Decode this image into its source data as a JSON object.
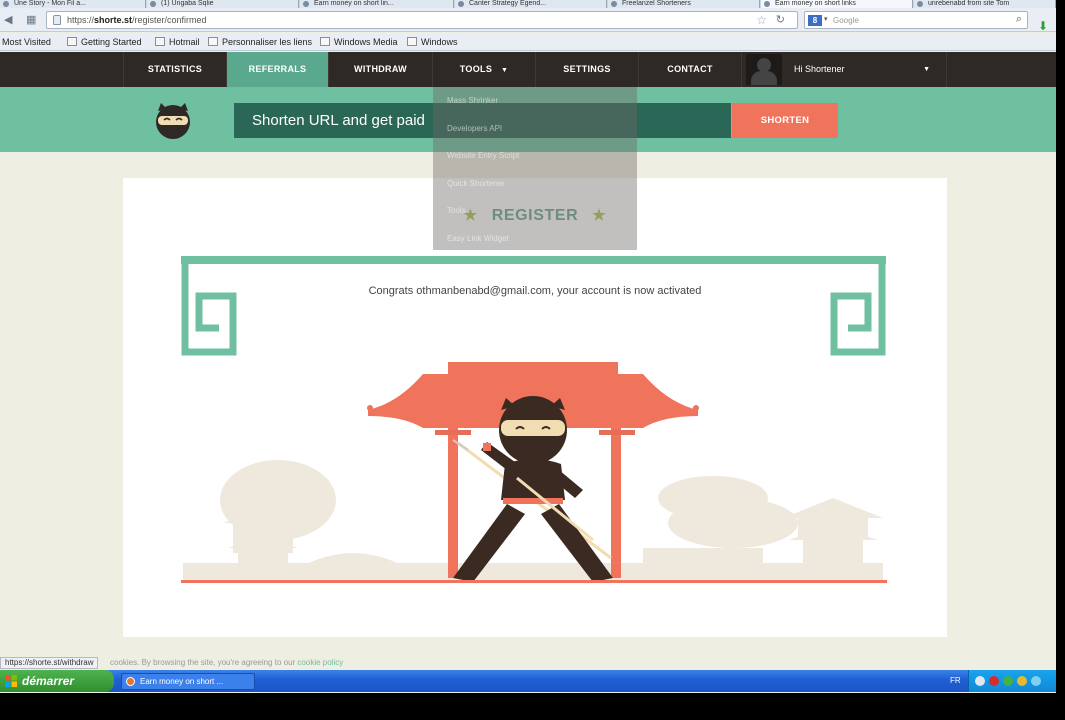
{
  "browser": {
    "tabs": [
      {
        "label": "Une Story - Mon Fil a..."
      },
      {
        "label": "(1) Ungaba Sqlie"
      },
      {
        "label": "Earn money on short lin..."
      },
      {
        "label": "Canter Strategy Egend..."
      },
      {
        "label": "Freelanzel Shorteners"
      },
      {
        "label": "Earn money on short links",
        "active": true
      },
      {
        "label": "unrebenabd from site Tom"
      }
    ],
    "url_prefix": "https://",
    "url_domain": "shorte.st",
    "url_path": "/register/confirmed",
    "search_placeholder": "Google",
    "bookmarks": [
      "Most Visited",
      "Getting Started",
      "Hotmail",
      "Personnaliser les liens",
      "Windows Media",
      "Windows"
    ]
  },
  "site": {
    "nav": [
      {
        "label": "STATISTICS"
      },
      {
        "label": "REFERRALS",
        "active": true
      },
      {
        "label": "WITHDRAW"
      },
      {
        "label": "TOOLS"
      },
      {
        "label": "SETTINGS"
      },
      {
        "label": "CONTACT"
      }
    ],
    "tools_caret": "▼",
    "user_greeting": "Hi Shortener",
    "shorten_placeholder": "Shorten URL and get paid",
    "shorten_button": "SHORTEN",
    "tools_menu": [
      "Mass Shrinker",
      "Developers API",
      "Website Entry Script",
      "Quick Shortener",
      "Tools",
      "Easy Link Widget"
    ],
    "register_title": "REGISTER",
    "congrats": "Congrats othmanbenabd@gmail.com, your account is now activated",
    "cookie_text": "cookies. By browsing the site, you're agreeing to our",
    "cookie_link": "cookie policy"
  },
  "status_url": "https://shorte.st/withdraw",
  "taskbar": {
    "start": "démarrer",
    "task": "Earn money on short ...",
    "lang": "FR"
  },
  "colors": {
    "teal": "#6fc0a1",
    "dark_teal": "#2b6756",
    "coral": "#f0745c",
    "nav_bg": "#2f2926"
  }
}
